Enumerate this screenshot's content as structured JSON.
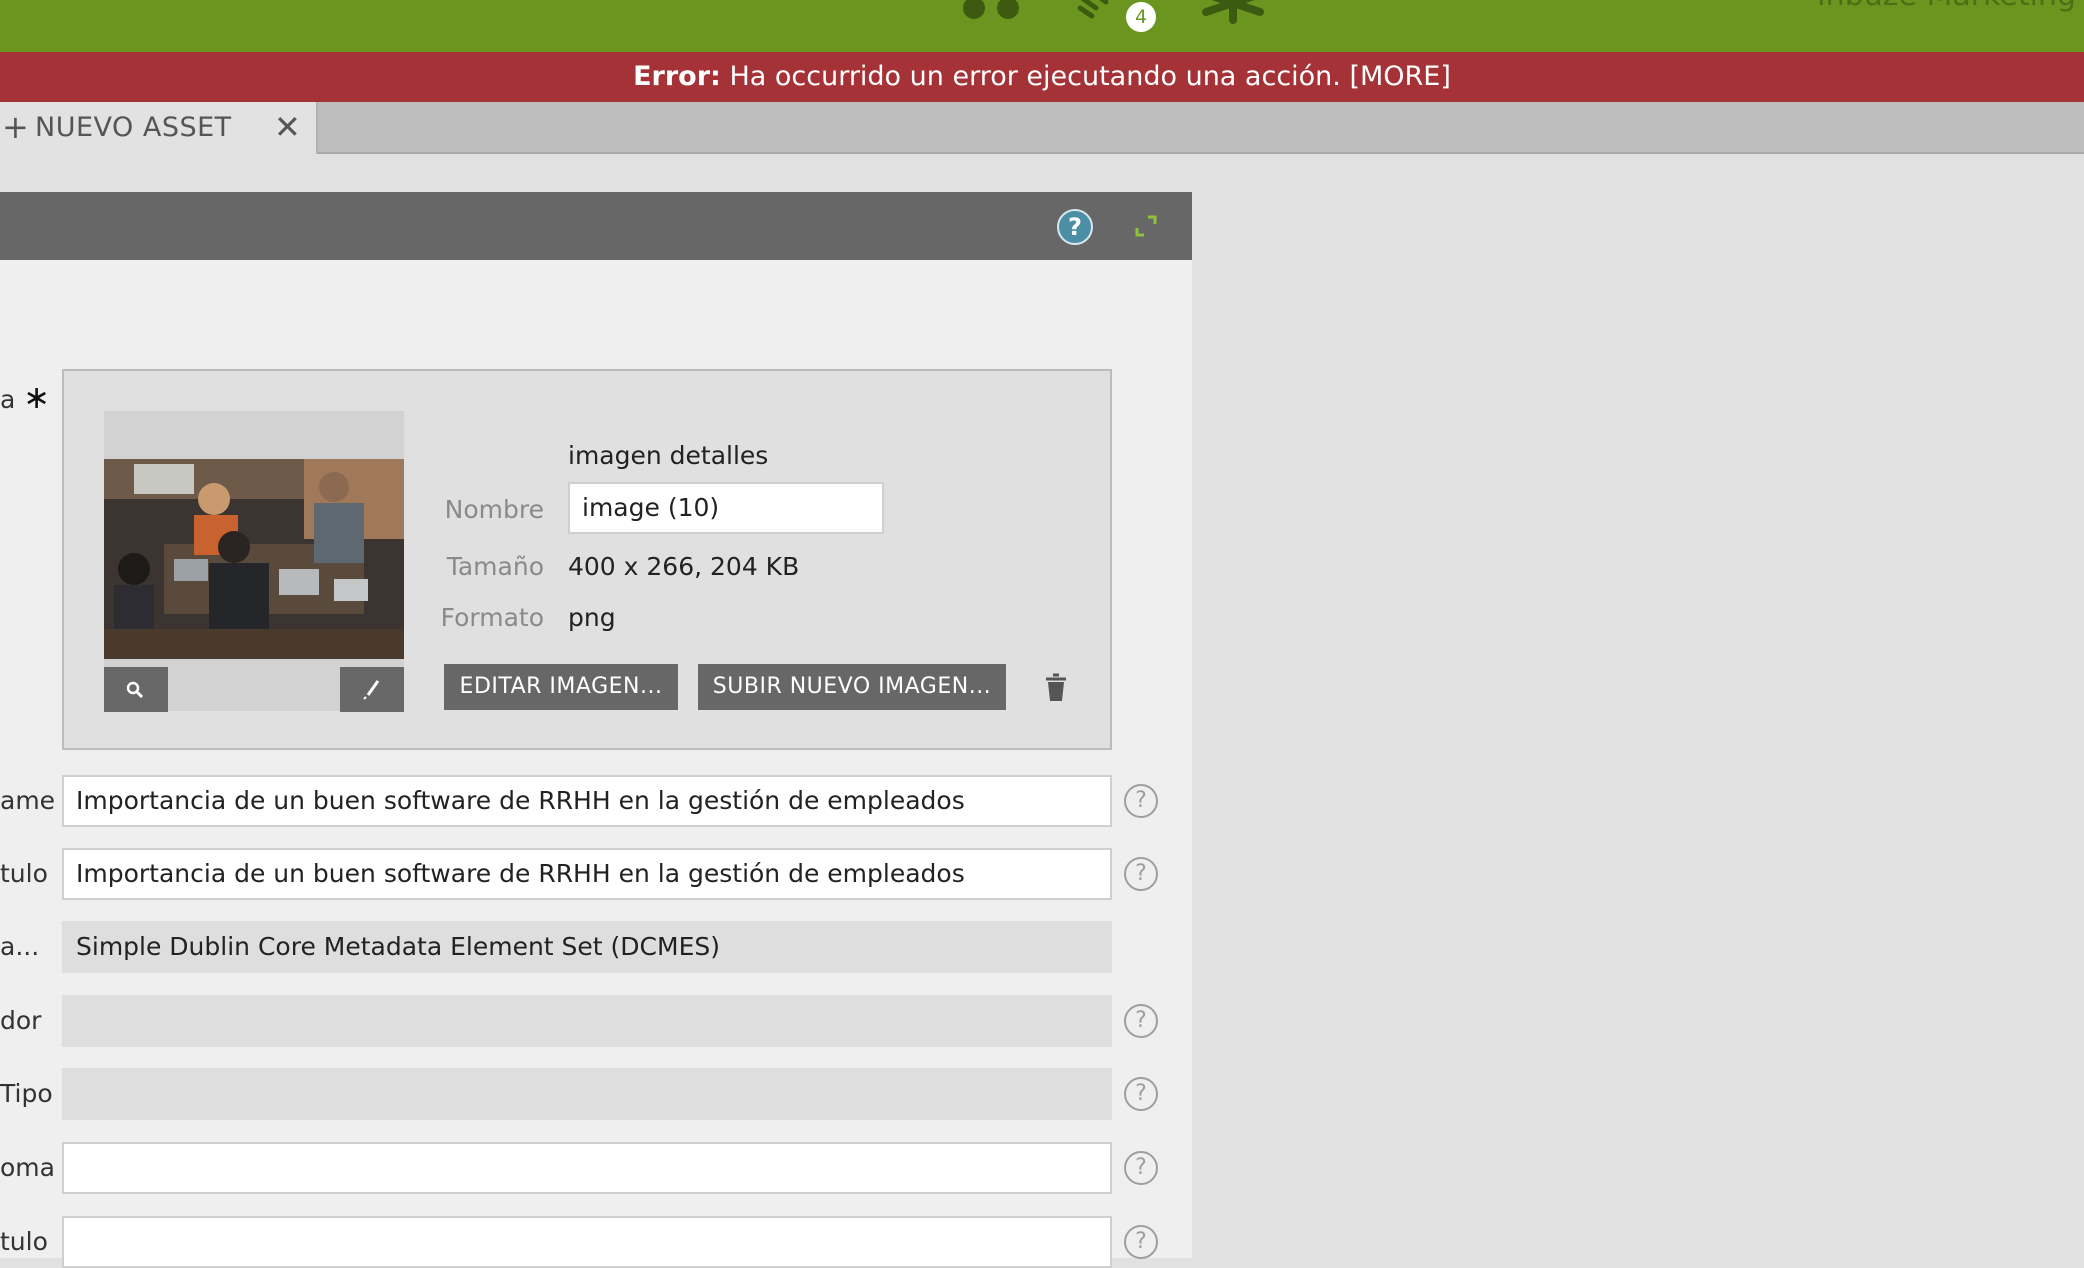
{
  "topbar": {
    "notification_count": "4",
    "user_name": "Inbuze Marketing",
    "icons": [
      "people-icon",
      "antenna-icon",
      "star-icon"
    ]
  },
  "error": {
    "label": "Error:",
    "message": "Ha occurrido un error ejecutando una acción. [MORE]"
  },
  "tab": {
    "plus": "+",
    "label": "NUEVO ASSET",
    "close": "✕"
  },
  "panel": {
    "help": "?",
    "image_label": "a",
    "required_mark": "∗",
    "image": {
      "title": "imagen detalles",
      "name_label": "Nombre",
      "name_value": "image (10)",
      "size_label": "Tamaño",
      "size_value": "400 x 266, 204 KB",
      "format_label": "Formato",
      "format_value": "png",
      "edit_button": "EDITAR IMAGEN...",
      "upload_button": "SUBIR NUEVO IMAGEN..."
    },
    "fields": [
      {
        "label": "ame",
        "value": "Importancia de un buen software de RRHH en la gestión de empleados",
        "help": "?"
      },
      {
        "label": "tulo",
        "value": "Importancia de un buen software de RRHH en la gestión de empleados",
        "help": "?"
      },
      {
        "label": "a...",
        "value": "Simple Dublin Core Metadata Element Set (DCMES)"
      },
      {
        "label": "dor",
        "value": "",
        "help": "?"
      },
      {
        "label": "Tipo",
        "value": "",
        "help": "?"
      },
      {
        "label": "oma",
        "value": "",
        "help": "?"
      },
      {
        "label": "tulo",
        "value": "",
        "help": "?"
      }
    ]
  },
  "colors": {
    "topbar": "#6a961f",
    "error": "#a43236",
    "header": "#676767",
    "help_icon": "#4b8ea6"
  }
}
